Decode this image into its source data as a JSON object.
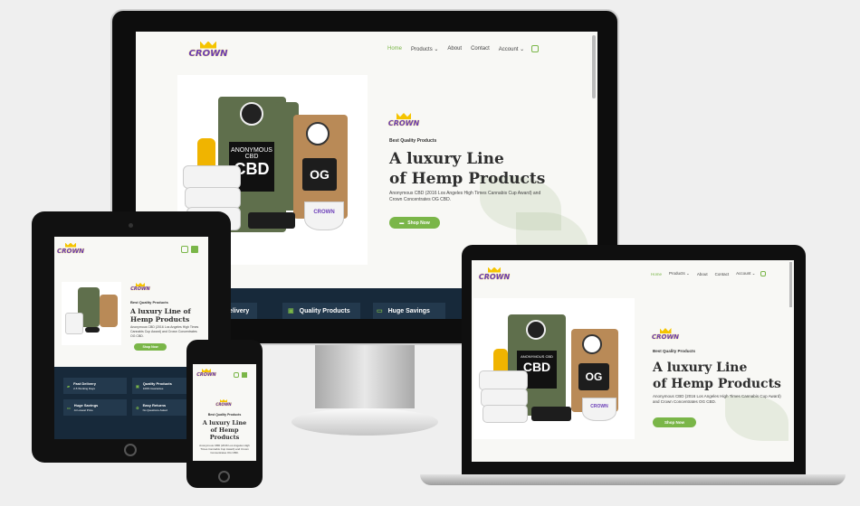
{
  "brand": {
    "logo_text": "CROWN"
  },
  "nav": {
    "items": [
      "Home",
      "Products",
      "About",
      "Contact",
      "Account"
    ],
    "active": "Home"
  },
  "hero": {
    "kicker": "Best Quality Products",
    "title_line1": "A luxury Line",
    "title_line2": "of Hemp Products",
    "description": "Anonymous CBD (2016 Los Angeles High Times Cannabis Cup Award) and Crown Concentrates OG CBD.",
    "cta": "Shop Now"
  },
  "product_labels": {
    "bag1": "ANONYMOUS CBD",
    "bag1_big": "CBD",
    "bag2": "OG",
    "tub": "CROWN"
  },
  "features": [
    {
      "title": "Fast Delivery",
      "sub": "2-5 Working Days",
      "icon": "truck-icon"
    },
    {
      "title": "Quality Products",
      "sub": "100% Guarantee",
      "icon": "badge-icon"
    },
    {
      "title": "Huge Savings",
      "sub": "At Lowest Price",
      "icon": "money-icon"
    },
    {
      "title": "Easy Returns",
      "sub": "No Questions Asked",
      "icon": "recycle-icon"
    }
  ],
  "desktop_strip_visible": [
    "Delivery",
    "Quality Products",
    "Huge Savings"
  ],
  "tablet_title": "A luxury Line of Hemp Products",
  "phone_title_line1": "A luxury Line",
  "phone_title_line2": "of Hemp",
  "phone_title_line3": "Products",
  "colors": {
    "accent": "#7ab648",
    "dark_strip": "#17293a",
    "background": "#efefef"
  }
}
